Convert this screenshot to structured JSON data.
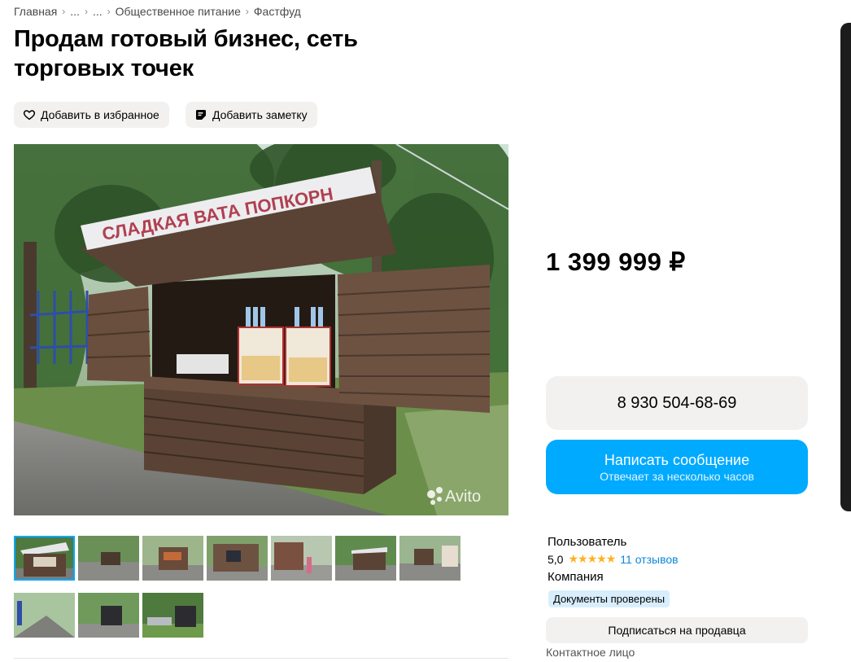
{
  "breadcrumbs": [
    "Главная",
    "...",
    "...",
    "Общественное питание",
    "Фастфуд"
  ],
  "title": "Продам готовый бизнес, сеть торговых точек",
  "actions": {
    "favorite_label": "Добавить в избранное",
    "note_label": "Добавить заметку"
  },
  "photo": {
    "sign_text": "СЛАДКАЯ ВАТА  ПОПКОРН",
    "watermark": "Avito",
    "thumbnail_count": 10,
    "selected_index": 0
  },
  "price": "1 399 999 ₽",
  "phone": "8 930 504-68-69",
  "message_button": {
    "label": "Написать сообщение",
    "subtitle": "Отвечает за несколько часов"
  },
  "seller": {
    "type": "Пользователь",
    "rating": "5,0",
    "stars": 5,
    "reviews": "11 отзывов",
    "kind": "Компания",
    "badge": "Документы проверены",
    "subscribe_label": "Подписаться на продавца",
    "contact_label": "Контактное лицо"
  },
  "colors": {
    "accent": "#00aaff",
    "star": "#ffb021",
    "button_bg": "#f2f1f0",
    "badge_bg": "#d8eefc",
    "link": "#0a88d8"
  }
}
